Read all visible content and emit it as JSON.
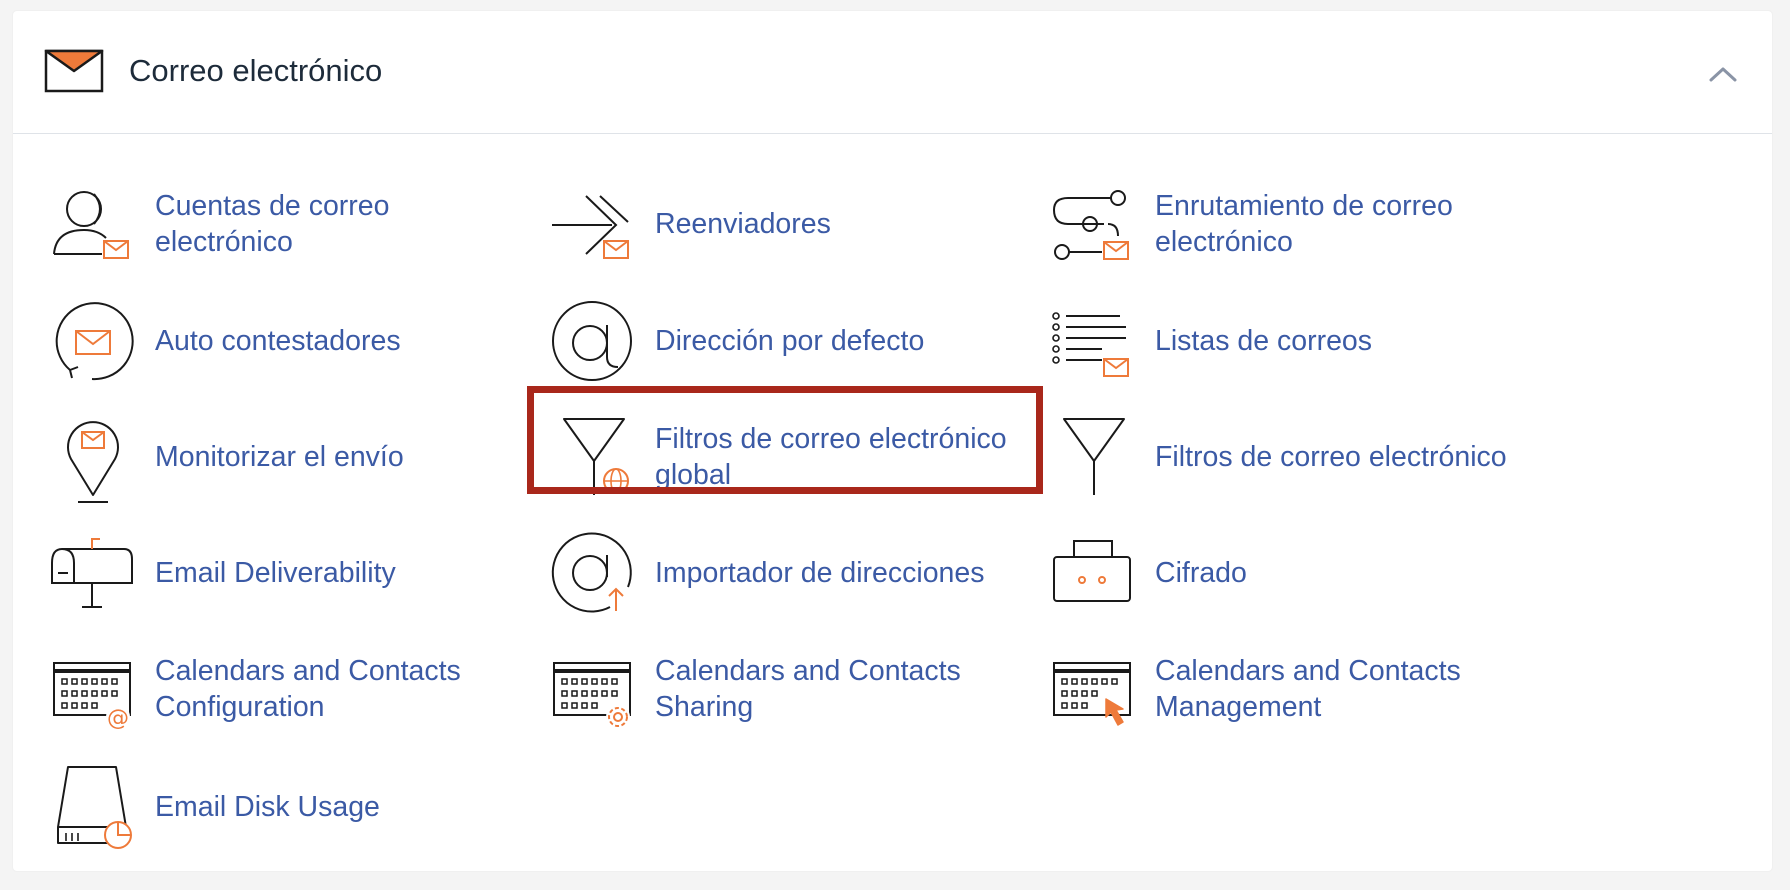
{
  "section": {
    "title": "Correo electrónico",
    "icon": "envelope-icon",
    "collapse_icon": "chevron-up-icon"
  },
  "colors": {
    "accent": "#ee7a3a",
    "link": "#3b5aa5",
    "highlight_border": "#a9271b"
  },
  "items": [
    {
      "label": "Cuentas de correo\nelectrónico",
      "icon": "user-mail-icon"
    },
    {
      "label": "Reenviadores",
      "icon": "forward-mail-icon"
    },
    {
      "label": "Enrutamiento de correo\nelectrónico",
      "icon": "routing-mail-icon"
    },
    {
      "label": "Auto contestadores",
      "icon": "autoresponder-icon"
    },
    {
      "label": "Dirección por defecto",
      "icon": "at-sign-icon"
    },
    {
      "label": "Listas de correos",
      "icon": "mailing-list-icon"
    },
    {
      "label": "Monitorizar el envío",
      "icon": "track-delivery-icon"
    },
    {
      "label": "Filtros de correo electrónico\nglobal",
      "icon": "global-filter-icon",
      "highlighted": true
    },
    {
      "label": "Filtros de correo electrónico",
      "icon": "filter-icon"
    },
    {
      "label": "Email Deliverability",
      "icon": "mailbox-icon"
    },
    {
      "label": "Importador de direcciones",
      "icon": "address-importer-icon"
    },
    {
      "label": "Cifrado",
      "icon": "encryption-icon"
    },
    {
      "label": "Calendars and Contacts\nConfiguration",
      "icon": "calendar-config-icon"
    },
    {
      "label": "Calendars and Contacts\nSharing",
      "icon": "calendar-sharing-icon"
    },
    {
      "label": "Calendars and Contacts\nManagement",
      "icon": "calendar-management-icon"
    },
    {
      "label": "Email Disk Usage",
      "icon": "disk-usage-icon"
    }
  ]
}
